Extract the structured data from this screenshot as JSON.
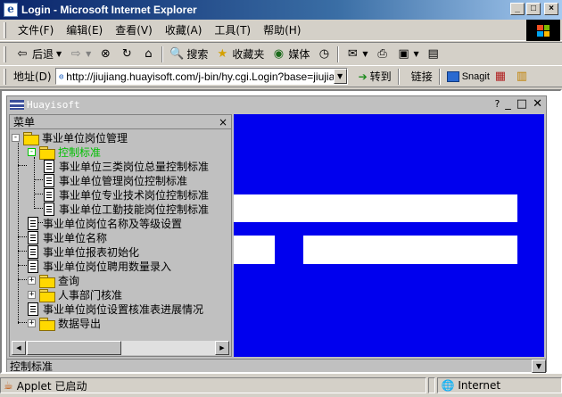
{
  "window": {
    "title": "Login - Microsoft Internet Explorer"
  },
  "menubar": {
    "items": [
      "文件(F)",
      "编辑(E)",
      "查看(V)",
      "收藏(A)",
      "工具(T)",
      "帮助(H)"
    ]
  },
  "toolbar": {
    "back": "后退",
    "search": "搜索",
    "favorites": "收藏夹",
    "media": "媒体"
  },
  "address": {
    "label": "地址(D)",
    "url": "http://jiujiang.huayisoft.com/j-bin/hy.cgi.Login?base=jiujiang",
    "go": "转到",
    "links": "链接",
    "snagit": "Snagit"
  },
  "applet": {
    "title": "Huayisoft",
    "help": "?"
  },
  "panel": {
    "title": "菜单",
    "close": "×"
  },
  "tree": [
    {
      "label": "事业单位岗位管理",
      "icon": "folder-open-icon",
      "expander": "-"
    },
    {
      "label": "控制标准",
      "icon": "folder-open-icon",
      "expander": "-",
      "selected": true
    },
    {
      "label": "事业单位三类岗位总量控制标准",
      "icon": "document-icon"
    },
    {
      "label": "事业单位管理岗位控制标准",
      "icon": "document-icon"
    },
    {
      "label": "事业单位专业技术岗位控制标准",
      "icon": "document-icon"
    },
    {
      "label": "事业单位工勤技能岗位控制标准",
      "icon": "document-icon"
    },
    {
      "label": "事业单位岗位名称及等级设置",
      "icon": "document-icon"
    },
    {
      "label": "事业单位名称",
      "icon": "document-icon"
    },
    {
      "label": "事业单位报表初始化",
      "icon": "document-icon"
    },
    {
      "label": "事业单位岗位聘用数量录入",
      "icon": "document-icon"
    },
    {
      "label": "查询",
      "icon": "folder-icon",
      "expander": "+"
    },
    {
      "label": "人事部门核准",
      "icon": "folder-icon",
      "expander": "+"
    },
    {
      "label": "事业单位岗位设置核准表进展情况",
      "icon": "document-icon"
    },
    {
      "label": "数据导出",
      "icon": "folder-icon",
      "expander": "+"
    }
  ],
  "status_inner": "控制标准",
  "statusbar": {
    "left": "Applet 已启动",
    "zone": "Internet"
  },
  "colors": {
    "applet_bg": "#0000ee",
    "selected_node": "#00c000",
    "titlebar": "#0a246a"
  }
}
